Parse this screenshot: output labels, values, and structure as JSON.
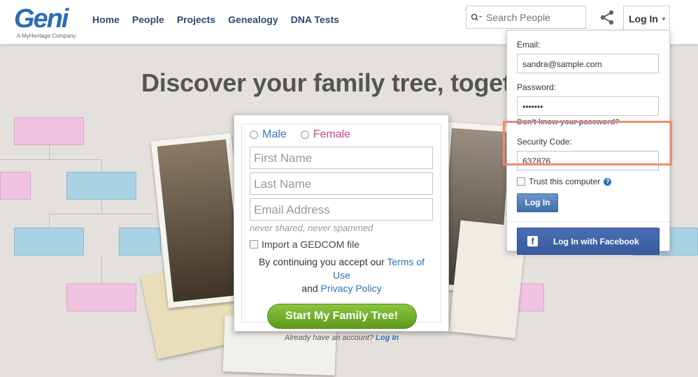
{
  "logo": {
    "word": "Geni",
    "tagline": "A MyHeritage Company"
  },
  "nav": {
    "items": [
      "Home",
      "People",
      "Projects",
      "Genealogy",
      "DNA Tests"
    ]
  },
  "search": {
    "placeholder": "Search People",
    "icon": "search-icon"
  },
  "header": {
    "login_label": "Log In"
  },
  "hero": {
    "headline": "Discover your family tree, toget"
  },
  "signup": {
    "male_label": "Male",
    "female_label": "Female",
    "first_name_placeholder": "First Name",
    "last_name_placeholder": "Last Name",
    "email_placeholder": "Email Address",
    "email_hint": "never shared, never spammed",
    "gedcom_label": "Import a GEDCOM file",
    "terms_prefix": "By continuing you accept our",
    "terms_link": "Terms of Use",
    "terms_and": "and",
    "privacy_link": "Privacy Policy",
    "start_button": "Start My Family Tree!",
    "already_text": "Already have an account?",
    "already_link": "Log In"
  },
  "login_dropdown": {
    "email_label": "Email:",
    "email_value": "sandra@sample.com",
    "password_label": "Password:",
    "password_value": "•••••••",
    "forgot_link": "Don't know your password?",
    "security_label": "Security Code:",
    "security_value": "637876",
    "trust_label": "Trust this computer",
    "help_icon": "question-icon",
    "login_button": "Log In",
    "facebook_button": "Log In with Facebook",
    "facebook_icon": "facebook-icon"
  },
  "colors": {
    "brand": "#2a6db5",
    "highlight": "#f08b6b",
    "start_green": "#6fad26",
    "facebook": "#3b5998"
  }
}
